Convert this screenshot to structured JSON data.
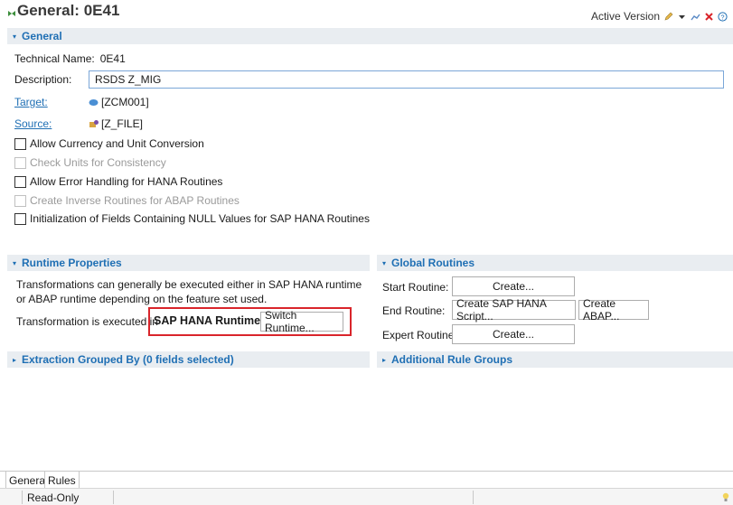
{
  "editor": {
    "title": "General: 0E41",
    "active_version": "Active Version"
  },
  "general": {
    "header": "General",
    "technical_name_label": "Technical Name:",
    "technical_name_value": "0E41",
    "description_label": "Description:",
    "description_value": "RSDS Z_MIG",
    "target_label": "Target:",
    "target_value": "[ZCM001]",
    "source_label": "Source:",
    "source_value": "[Z_FILE]",
    "options": [
      {
        "label": "Allow Currency and Unit Conversion",
        "checked": false,
        "enabled": true
      },
      {
        "label": "Check Units for Consistency",
        "checked": false,
        "enabled": false
      },
      {
        "label": "Allow Error Handling for HANA Routines",
        "checked": false,
        "enabled": true
      },
      {
        "label": "Create Inverse Routines for ABAP Routines",
        "checked": false,
        "enabled": false
      },
      {
        "label": "Initialization of Fields Containing NULL Values for SAP HANA Routines",
        "checked": false,
        "enabled": true
      }
    ]
  },
  "runtime": {
    "header": "Runtime Properties",
    "text_line1": "Transformations can generally be executed either in SAP HANA runtime",
    "text_line2": "or ABAP runtime depending on the feature set used.",
    "executed_label": "Transformation is executed in",
    "runtime_value": "SAP HANA Runtime.",
    "switch_button": "Switch Runtime..."
  },
  "global_routines": {
    "header": "Global Routines",
    "start_label": "Start Routine:",
    "start_button": "Create...",
    "end_label": "End Routine:",
    "end_hana_button": "Create SAP HANA Script...",
    "end_abap_button": "Create ABAP...",
    "expert_label": "Expert Routine:",
    "expert_button": "Create..."
  },
  "extraction": {
    "header": "Extraction Grouped By (0 fields selected)"
  },
  "additional": {
    "header": "Additional Rule Groups"
  },
  "tabs": {
    "general": "General",
    "rules": "Rules"
  },
  "status": {
    "mode": "Read-Only"
  },
  "colors": {
    "accent": "#1f6fb4",
    "highlight": "#d9252b",
    "section_bg": "#e9edf1"
  }
}
